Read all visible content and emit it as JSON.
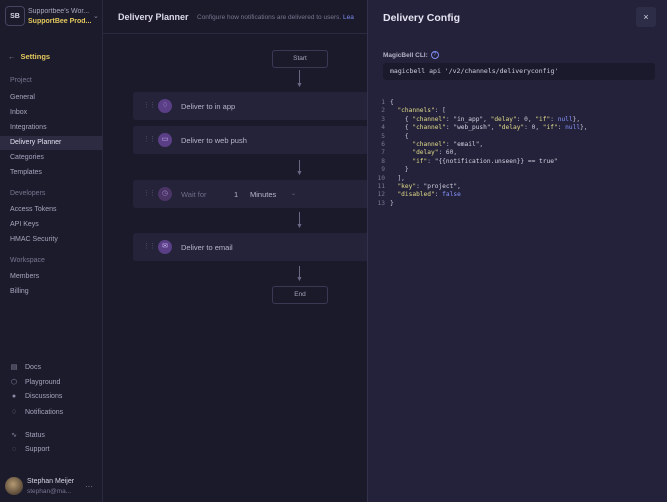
{
  "workspace": {
    "initials": "SB",
    "name": "Supportbee's Wor...",
    "project": "SupportBee Prod..."
  },
  "sidebar": {
    "back_label": "Settings",
    "sections": [
      {
        "title": "Project",
        "items": [
          "General",
          "Inbox",
          "Integrations",
          "Delivery Planner",
          "Categories",
          "Templates"
        ]
      },
      {
        "title": "Developers",
        "items": [
          "Access Tokens",
          "API Keys",
          "HMAC Security"
        ]
      },
      {
        "title": "Workspace",
        "items": [
          "Members",
          "Billing"
        ]
      }
    ],
    "active_item": "Delivery Planner",
    "footer": [
      {
        "label": "Docs",
        "icon": "book-icon"
      },
      {
        "label": "Playground",
        "icon": "cube-icon"
      },
      {
        "label": "Discussions",
        "icon": "github-icon"
      },
      {
        "label": "Notifications",
        "icon": "bell-icon"
      },
      {
        "label": "Status",
        "icon": "pulse-icon"
      },
      {
        "label": "Support",
        "icon": "chat-icon"
      }
    ],
    "user": {
      "name": "Stephan Meijer",
      "email": "stephan@ma..."
    }
  },
  "header": {
    "title": "Delivery Planner",
    "subtitle": "Configure how notifications are delivered to users.",
    "link": "Lea"
  },
  "planner": {
    "start": "Start",
    "end": "End",
    "steps": [
      {
        "label": "Deliver to in app",
        "icon": "bell-icon"
      },
      {
        "label": "Deliver to web push",
        "icon": "monitor-icon"
      },
      {
        "label": "Wait for",
        "icon": "clock-icon",
        "value": "1",
        "unit": "Minutes"
      },
      {
        "label": "Deliver to email",
        "icon": "mail-icon"
      }
    ]
  },
  "panel": {
    "title": "Delivery Config",
    "close": "×",
    "cli_label": "MagicBell CLI:",
    "cli_command": "magicbell api '/v2/channels/deliveryconfig'",
    "code_lines": [
      "{",
      "  \"channels\": [",
      "    { \"channel\": \"in_app\", \"delay\": 0, \"if\": null},",
      "    { \"channel\": \"web_push\", \"delay\": 0, \"if\": null},",
      "    {",
      "      \"channel\": \"email\",",
      "      \"delay\": 60,",
      "      \"if\": \"{{notification.unseen}} == true\"",
      "    }",
      "  ],",
      "  \"key\": \"project\",",
      "  \"disabled\": false",
      "}"
    ]
  },
  "colors": {
    "accent": "#e3c85c",
    "link": "#7e8cf0",
    "step_icon": "#5a3f86"
  }
}
